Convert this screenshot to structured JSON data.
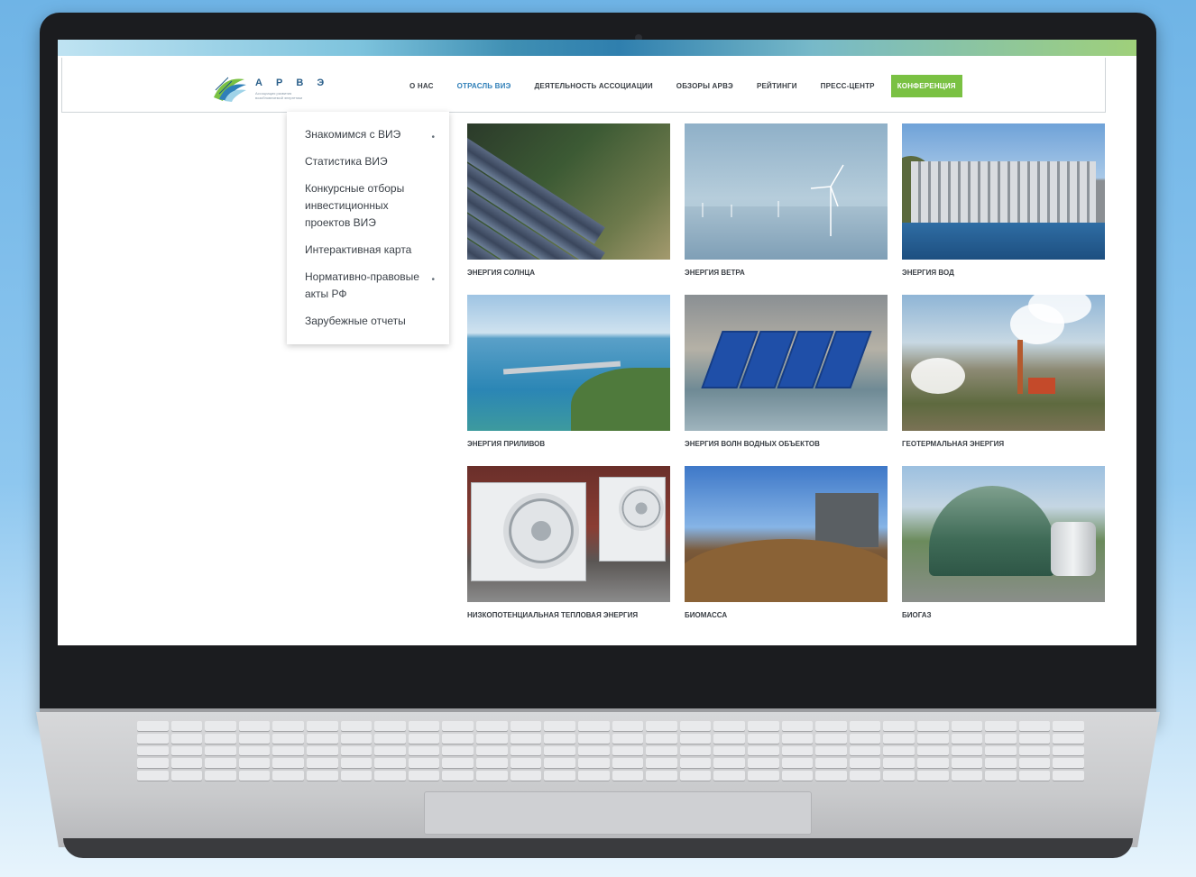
{
  "site": {
    "logo_name": "А Р В Э",
    "logo_sub": "Ассоциация развития возобновляемой энергетики"
  },
  "nav": {
    "items": [
      {
        "label": "О нас",
        "active": false
      },
      {
        "label": "Отрасль ВИЭ",
        "active": true
      },
      {
        "label": "Деятельность Ассоциации",
        "active": false
      },
      {
        "label": "Обзоры АРВЭ",
        "active": false
      },
      {
        "label": "Рейтинги",
        "active": false
      },
      {
        "label": "Пресс-центр",
        "active": false
      }
    ],
    "cta_label": "Конференция"
  },
  "dropdown": {
    "items": [
      {
        "label": "Знакомимся с ВИЭ",
        "has_submenu": true
      },
      {
        "label": "Статистика ВИЭ",
        "has_submenu": false
      },
      {
        "label": "Конкурсные отборы инвестиционных проектов ВИЭ",
        "has_submenu": false
      },
      {
        "label": "Интерактивная карта",
        "has_submenu": false
      },
      {
        "label": "Нормативно-правовые акты РФ",
        "has_submenu": true
      },
      {
        "label": "Зарубежные отчеты",
        "has_submenu": false
      }
    ],
    "submenu_marker": "•"
  },
  "tiles": [
    {
      "caption": "Энергия солнца",
      "image": "solar-panels"
    },
    {
      "caption": "Энергия ветра",
      "image": "offshore-wind-turbines"
    },
    {
      "caption": "Энергия вод",
      "image": "hydro-dam"
    },
    {
      "caption": "Энергия приливов",
      "image": "tidal-barrage"
    },
    {
      "caption": "Энергия волн водных объектов",
      "image": "wave-energy-floats"
    },
    {
      "caption": "Геотермальная энергия",
      "image": "geothermal-plant"
    },
    {
      "caption": "Низкопотенциальная тепловая энергия",
      "image": "heat-pump-units"
    },
    {
      "caption": "Биомасса",
      "image": "biomass-pile"
    },
    {
      "caption": "Биогаз",
      "image": "biogas-dome"
    }
  ],
  "colors": {
    "accent_blue": "#2f7fb8",
    "cta_green": "#7ac143",
    "text": "#3a3f45"
  }
}
